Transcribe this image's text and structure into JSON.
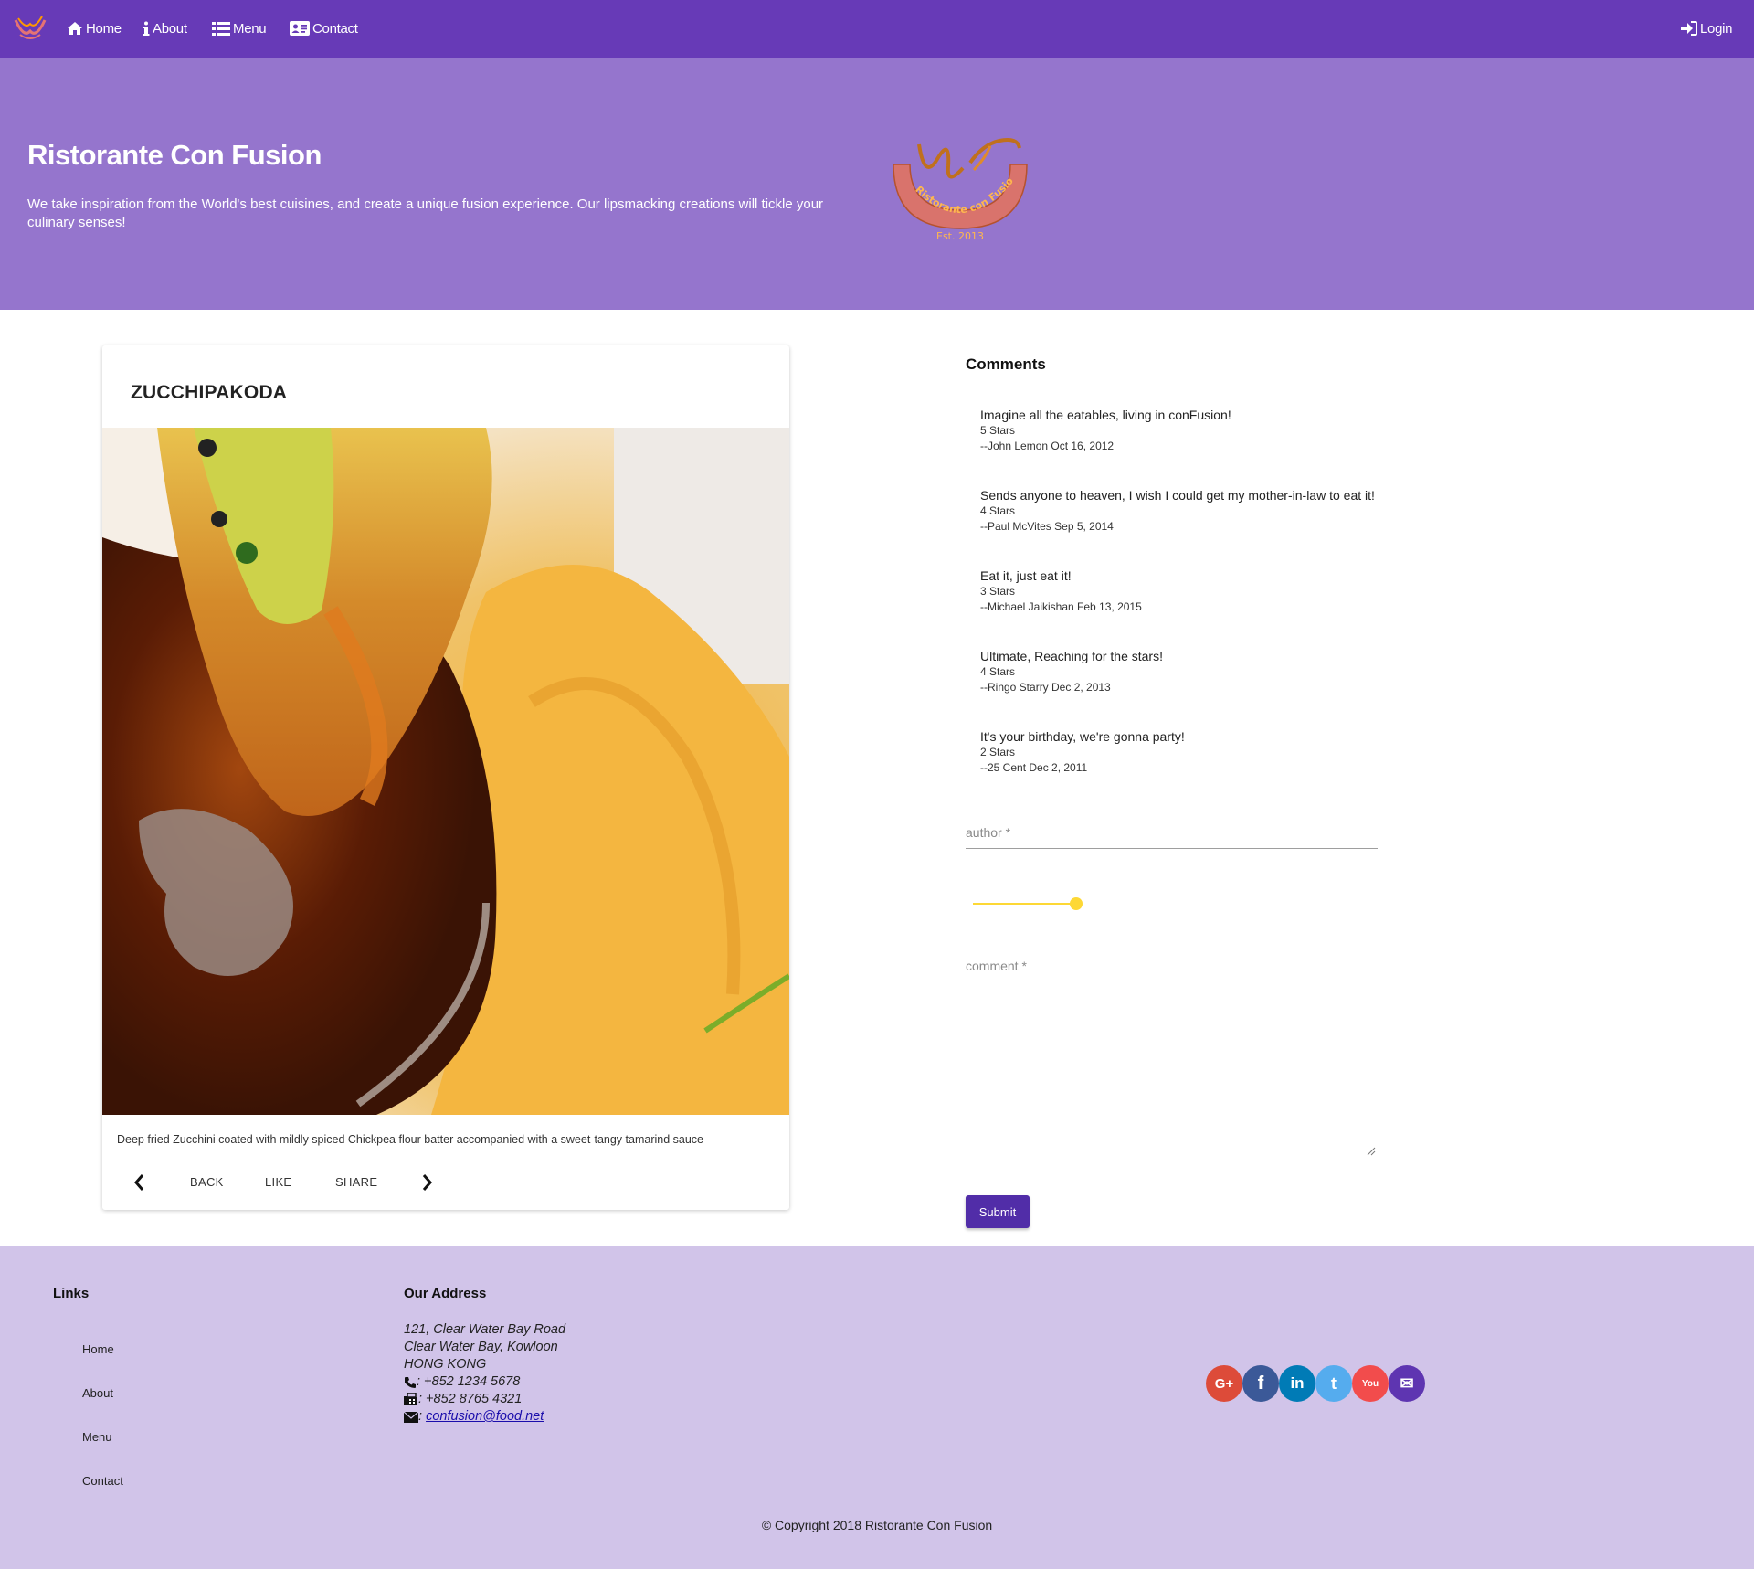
{
  "navbar": {
    "items": [
      {
        "label": "Home",
        "icon": "home-icon"
      },
      {
        "label": "About",
        "icon": "info-icon"
      },
      {
        "label": "Menu",
        "icon": "list-icon"
      },
      {
        "label": "Contact",
        "icon": "address-card-icon"
      }
    ],
    "login_label": "Login",
    "color": "#673ab7"
  },
  "jumbotron": {
    "title": "Ristorante Con Fusion",
    "text": "We take inspiration from the World's best cuisines, and create a unique fusion experience. Our lipsmacking creations will tickle your culinary senses!",
    "logo_text": "Ristorante con Fusion",
    "logo_est": "Est. 2013",
    "color": "#9575cd"
  },
  "dish": {
    "name": "ZUCCHIPAKODA",
    "description": "Deep fried Zucchini coated with mildly spiced Chickpea flour batter accompanied with a sweet-tangy tamarind sauce",
    "actions": {
      "back": "BACK",
      "like": "LIKE",
      "share": "SHARE"
    }
  },
  "comments": {
    "title": "Comments",
    "items": [
      {
        "text": "Imagine all the eatables, living in conFusion!",
        "rating": "5 Stars",
        "author": "--John Lemon Oct 16, 2012"
      },
      {
        "text": "Sends anyone to heaven, I wish I could get my mother-in-law to eat it!",
        "rating": "4 Stars",
        "author": "--Paul McVites Sep 5, 2014"
      },
      {
        "text": "Eat it, just eat it!",
        "rating": "3 Stars",
        "author": "--Michael Jaikishan Feb 13, 2015"
      },
      {
        "text": "Ultimate, Reaching for the stars!",
        "rating": "4 Stars",
        "author": "--Ringo Starry Dec 2, 2013"
      },
      {
        "text": "It's your birthday, we're gonna party!",
        "rating": "2 Stars",
        "author": "--25 Cent Dec 2, 2011"
      }
    ]
  },
  "form": {
    "author_placeholder": "author *",
    "comment_placeholder": "comment *",
    "rating_value": 5,
    "rating_max": 5,
    "submit_label": "Submit",
    "slider_color": "#fdd835",
    "submit_color": "#512da8"
  },
  "footer": {
    "links_title": "Links",
    "links": [
      "Home",
      "About",
      "Menu",
      "Contact"
    ],
    "address_title": "Our Address",
    "address": [
      "121, Clear Water Bay Road",
      "Clear Water Bay, Kowloon",
      "HONG KONG"
    ],
    "phone": ": +852 1234 5678",
    "fax": ": +852 8765 4321",
    "email_prefix": ":",
    "email": "confusion@food.net",
    "social": [
      {
        "name": "google-plus-icon",
        "color": "#dd4b39",
        "glyph": "G+"
      },
      {
        "name": "facebook-icon",
        "color": "#3b5998",
        "glyph": "f"
      },
      {
        "name": "linkedin-icon",
        "color": "#007bb6",
        "glyph": "in"
      },
      {
        "name": "twitter-icon",
        "color": "#55acee",
        "glyph": "t"
      },
      {
        "name": "youtube-icon",
        "color": "#f24c4c",
        "glyph": "You"
      },
      {
        "name": "mail-icon",
        "color": "#5e35b1",
        "glyph": "✉"
      }
    ],
    "copyright": "© Copyright 2018 Ristorante Con Fusion",
    "color": "#d1c4e9"
  }
}
